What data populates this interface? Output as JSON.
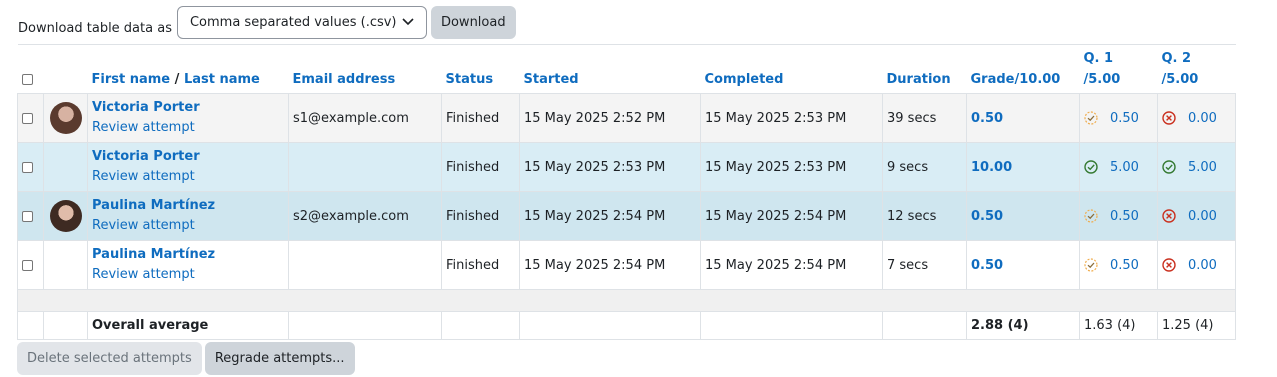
{
  "download": {
    "label": "Download table data as",
    "format": "Comma separated values (.csv)",
    "button": "Download"
  },
  "headers": {
    "first_name": "First name",
    "separator": " / ",
    "last_name": "Last name",
    "email": "Email address",
    "status": "Status",
    "started": "Started",
    "completed": "Completed",
    "duration": "Duration",
    "grade": "Grade/10.00",
    "q1_line1": "Q. 1",
    "q1_line2": "/5.00",
    "q2_line1": "Q. 2",
    "q2_line2": "/5.00"
  },
  "rows": [
    {
      "name": "Victoria Porter",
      "review": "Review attempt",
      "email": "s1@example.com",
      "status": "Finished",
      "started": "15 May 2025 2:52 PM",
      "completed": "15 May 2025 2:53 PM",
      "duration": "39 secs",
      "grade": "0.50",
      "q1": "0.50",
      "q1_icon": "partially-correct-icon",
      "q2": "0.00",
      "q2_icon": "incorrect-icon",
      "avatar": true
    },
    {
      "name": "Victoria Porter",
      "review": "Review attempt",
      "email": "",
      "status": "Finished",
      "started": "15 May 2025 2:53 PM",
      "completed": "15 May 2025 2:53 PM",
      "duration": "9 secs",
      "grade": "10.00",
      "q1": "5.00",
      "q1_icon": "correct-icon",
      "q2": "5.00",
      "q2_icon": "correct-icon",
      "avatar": false
    },
    {
      "name": "Paulina Martínez",
      "review": "Review attempt",
      "email": "s2@example.com",
      "status": "Finished",
      "started": "15 May 2025 2:54 PM",
      "completed": "15 May 2025 2:54 PM",
      "duration": "12 secs",
      "grade": "0.50",
      "q1": "0.50",
      "q1_icon": "partially-correct-icon",
      "q2": "0.00",
      "q2_icon": "incorrect-icon",
      "avatar": true
    },
    {
      "name": "Paulina Martínez",
      "review": "Review attempt",
      "email": "",
      "status": "Finished",
      "started": "15 May 2025 2:54 PM",
      "completed": "15 May 2025 2:54 PM",
      "duration": "7 secs",
      "grade": "0.50",
      "q1": "0.50",
      "q1_icon": "partially-correct-icon",
      "q2": "0.00",
      "q2_icon": "incorrect-icon",
      "avatar": false
    }
  ],
  "average": {
    "label": "Overall average",
    "grade": "2.88 (4)",
    "q1": "1.63 (4)",
    "q2": "1.25 (4)"
  },
  "colors": {
    "link": "#0f6cbf",
    "correct": "#357a32",
    "incorrect": "#ca3120",
    "partial": "#f0ad4e"
  },
  "actions": {
    "delete": "Delete selected attempts",
    "regrade": "Regrade attempts..."
  }
}
